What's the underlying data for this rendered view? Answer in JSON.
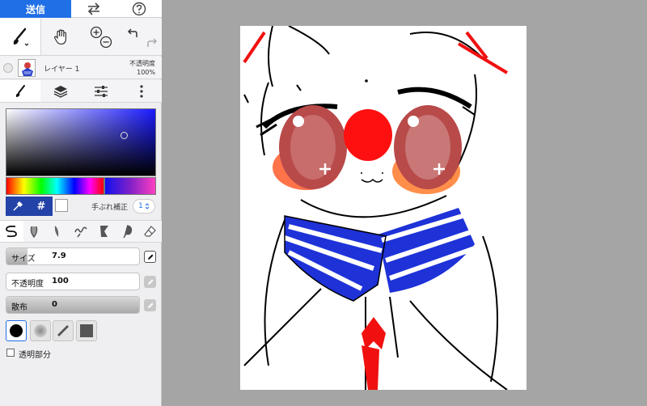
{
  "topbar": {
    "send_label": "送信",
    "swap_icon": "swap-arrows-icon",
    "help_icon": "help-icon"
  },
  "tools": {
    "brush_icon": "brush-icon",
    "hand_icon": "hand-icon",
    "zoom_icon": "zoom-icon",
    "undo_icon": "undo-icon",
    "redo_icon": "redo-icon"
  },
  "layer": {
    "name": "レイヤー 1",
    "opacity_label": "不透明度",
    "opacity_value": "100%"
  },
  "color": {
    "hex_label": "#",
    "current_color": "#ffffff",
    "stabilizer_label": "手ぶれ補正",
    "stabilizer_value": "1"
  },
  "sliders": [
    {
      "label": "サイズ",
      "value": "7.9",
      "fill_fraction": 0.16
    },
    {
      "label": "不透明度",
      "value": "100",
      "fill_fraction": 0.0
    },
    {
      "label": "散布",
      "value": "0",
      "fill_fraction": 1.0
    }
  ],
  "transparent": {
    "label": "透明部分"
  },
  "colors": {
    "accent": "#1f6fe6",
    "panel_bg": "#efeff1",
    "stage_bg": "#a5a5a5",
    "picker_btn": "#2443a8"
  }
}
